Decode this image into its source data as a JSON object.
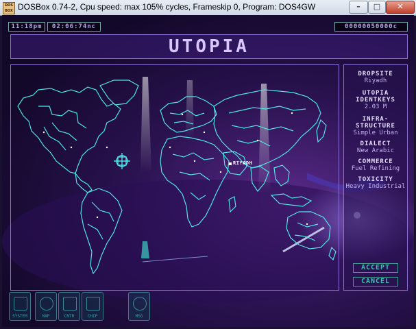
{
  "window": {
    "title": "DOSBox 0.74-2, Cpu speed: max 105% cycles, Frameskip  0, Program:    DOS4GW",
    "icon_text": "DOS BOX",
    "minimize_icon": "minimize-icon",
    "maximize_icon": "maximize-icon",
    "close_icon": "close-icon"
  },
  "hud": {
    "clock": "11:18pm",
    "date": "02:06:74nc",
    "credits": "00000050000c"
  },
  "header": {
    "title": "UTOPIA"
  },
  "map": {
    "city_label": "RIYADH",
    "line_color": "#4fe6e6",
    "cursor_icon": "target-crosshair-icon"
  },
  "sidebar": {
    "dropsite_label": "DROPSITE",
    "dropsite_value": "Riyadh",
    "identkeys_label_1": "UTOPIA",
    "identkeys_label_2": "IDENTKEYS",
    "identkeys_value": "2.03 M",
    "infra_label_1": "INFRA-",
    "infra_label_2": "STRUCTURE",
    "infra_value": "Simple Urban",
    "dialect_label": "DIALECT",
    "dialect_value": "New Arabic",
    "commerce_label": "COMMERCE",
    "commerce_value": "Fuel Refining",
    "toxicity_label": "TOXICITY",
    "toxicity_value": "Heavy Industrial"
  },
  "actions": {
    "accept": "ACCEPT",
    "cancel": "CANCEL"
  },
  "toolbar": [
    {
      "label": "SYSTEM",
      "icon": "system-icon"
    },
    {
      "label": "MAP",
      "icon": "globe-icon"
    },
    {
      "label": "CNTR",
      "icon": "control-icon"
    },
    {
      "label": "CHIP",
      "icon": "chip-icon"
    },
    {
      "label": "MSG",
      "icon": "message-icon"
    }
  ],
  "colors": {
    "accent": "#8d6fd8",
    "cyan": "#4fe6e6",
    "teal": "#40c0b0"
  }
}
